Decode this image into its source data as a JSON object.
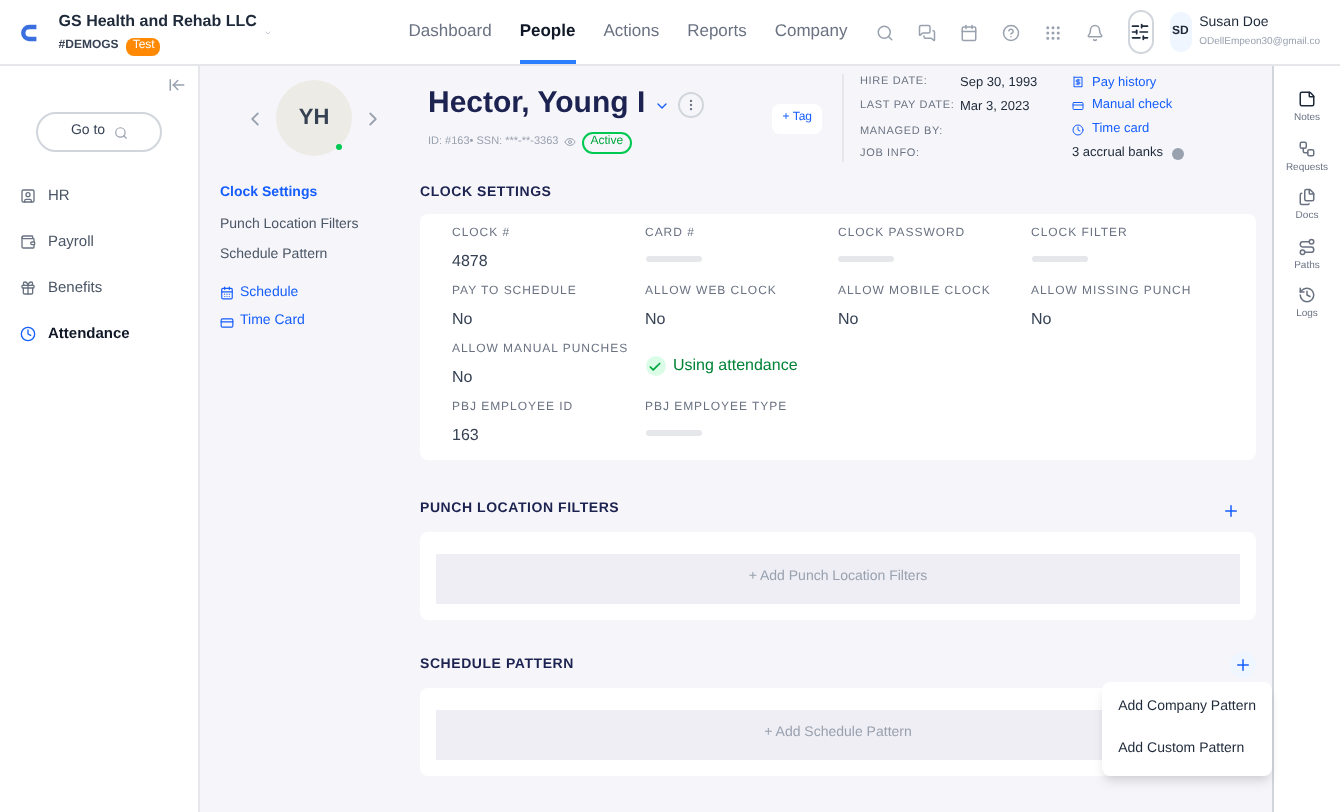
{
  "header": {
    "company_name": "GS Health and Rehab LLC",
    "company_code": "#DEMOGS",
    "badge": "Test",
    "nav": [
      {
        "label": "Dashboard",
        "selected": false
      },
      {
        "label": "People",
        "selected": true
      },
      {
        "label": "Actions",
        "selected": false
      },
      {
        "label": "Reports",
        "selected": false
      },
      {
        "label": "Company",
        "selected": false
      }
    ],
    "user": {
      "initials": "SD",
      "name": "Susan Doe",
      "email": "ODellEmpeon30@gmail.co"
    }
  },
  "sidebar": {
    "go_to": "Go to",
    "items": [
      {
        "label": "HR",
        "selected": false
      },
      {
        "label": "Payroll",
        "selected": false
      },
      {
        "label": "Benefits",
        "selected": false
      },
      {
        "label": "Attendance",
        "selected": true
      }
    ]
  },
  "profile": {
    "initials": "YH",
    "name": "Hector, Young I",
    "id_line": "ID: #163• SSN: ***-**-3363",
    "status": "Active",
    "tag": "+ Tag",
    "info": [
      {
        "label": "HIRE DATE:",
        "value": "Sep 30, 1993"
      },
      {
        "label": "LAST PAY DATE:",
        "value": "Mar 3, 2023"
      },
      {
        "label": "MANAGED BY:"
      },
      {
        "label": "JOB INFO:"
      }
    ],
    "links": [
      "Pay history",
      "Manual check",
      "Time card"
    ],
    "accrual": "3 accrual banks"
  },
  "subnav": {
    "items": [
      {
        "label": "Clock Settings",
        "selected": true
      },
      {
        "label": "Punch Location Filters",
        "selected": false
      },
      {
        "label": "Schedule Pattern",
        "selected": false
      }
    ],
    "quick_links": [
      "Schedule",
      "Time Card"
    ]
  },
  "clock_settings": {
    "title": "CLOCK SETTINGS",
    "rows": [
      [
        {
          "kind": "field",
          "label": "CLOCK #",
          "value": "4878"
        },
        {
          "kind": "field",
          "label": "CARD #"
        },
        {
          "kind": "field",
          "label": "CLOCK PASSWORD"
        },
        {
          "kind": "field",
          "label": "CLOCK FILTER"
        }
      ],
      [
        {
          "kind": "field",
          "label": "PAY TO SCHEDULE",
          "value": "No"
        },
        {
          "kind": "field",
          "label": "ALLOW WEB CLOCK",
          "value": "No"
        },
        {
          "kind": "field",
          "label": "ALLOW MOBILE CLOCK",
          "value": "No"
        },
        {
          "kind": "field",
          "label": "ALLOW MISSING PUNCH",
          "value": "No"
        }
      ],
      [
        {
          "kind": "field",
          "label": "ALLOW MANUAL PUNCHES",
          "value": "No"
        },
        {
          "kind": "check",
          "label": "Using attendance"
        }
      ],
      [
        {
          "kind": "field",
          "label": "PBJ EMPLOYEE ID",
          "value": "163"
        },
        {
          "kind": "field",
          "label": "PBJ EMPLOYEE TYPE"
        }
      ]
    ]
  },
  "punch_location_filters": {
    "title": "PUNCH LOCATION FILTERS",
    "add_button": "+ Add Punch Location Filters"
  },
  "schedule_pattern": {
    "title": "SCHEDULE PATTERN",
    "add_button": "+ Add Schedule Pattern",
    "menu": [
      "Add Company Pattern",
      "Add Custom Pattern"
    ]
  },
  "rail": [
    "Notes",
    "Requests",
    "Docs",
    "Paths",
    "Logs"
  ]
}
